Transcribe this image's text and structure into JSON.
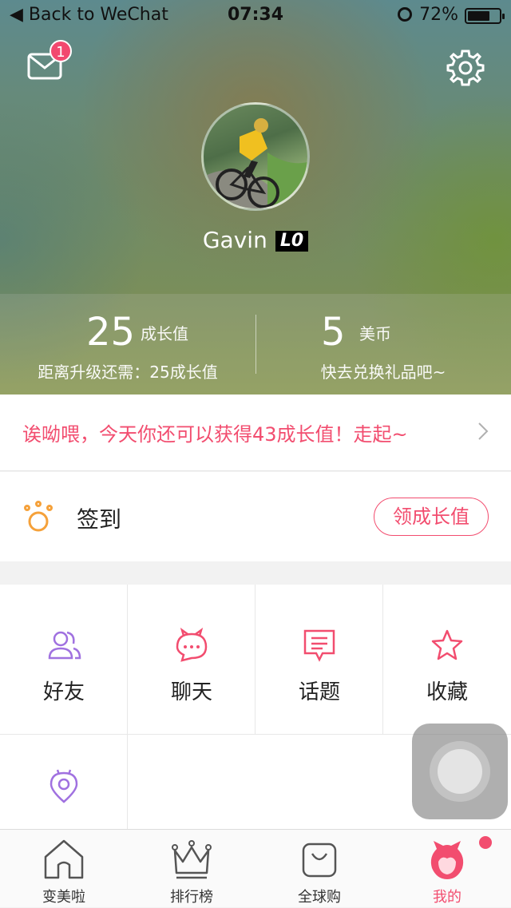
{
  "status_bar": {
    "back_label": "Back to WeChat",
    "time": "07:34",
    "battery_percent_text": "72%",
    "battery_level": 0.72
  },
  "header": {
    "mail_badge_count": "1",
    "username": "Gavin",
    "level_badge": "L0",
    "growth": {
      "value": "25",
      "unit": "成长值",
      "sub": "距离升级还需：25成长值"
    },
    "coins": {
      "value": "5",
      "unit": "美币",
      "sub": "快去兑换礼品吧~"
    }
  },
  "promo": {
    "text": "诶呦喂，今天你还可以获得43成长值！走起~"
  },
  "signin": {
    "label": "签到",
    "button": "领成长值"
  },
  "grid": {
    "items": [
      {
        "label": "好友",
        "icon": "friends-icon"
      },
      {
        "label": "聊天",
        "icon": "chat-icon"
      },
      {
        "label": "话题",
        "icon": "topic-icon"
      },
      {
        "label": "收藏",
        "icon": "star-icon"
      },
      {
        "label": "",
        "icon": "location-icon"
      }
    ]
  },
  "tabbar": {
    "tabs": [
      {
        "label": "变美啦",
        "icon": "home-icon"
      },
      {
        "label": "排行榜",
        "icon": "crown-icon"
      },
      {
        "label": "全球购",
        "icon": "bag-icon"
      },
      {
        "label": "我的",
        "icon": "profile-icon"
      }
    ],
    "active_index": 3
  },
  "colors": {
    "accent": "#f24d6f",
    "purple": "#a071e0",
    "orange": "#f5a13a"
  }
}
